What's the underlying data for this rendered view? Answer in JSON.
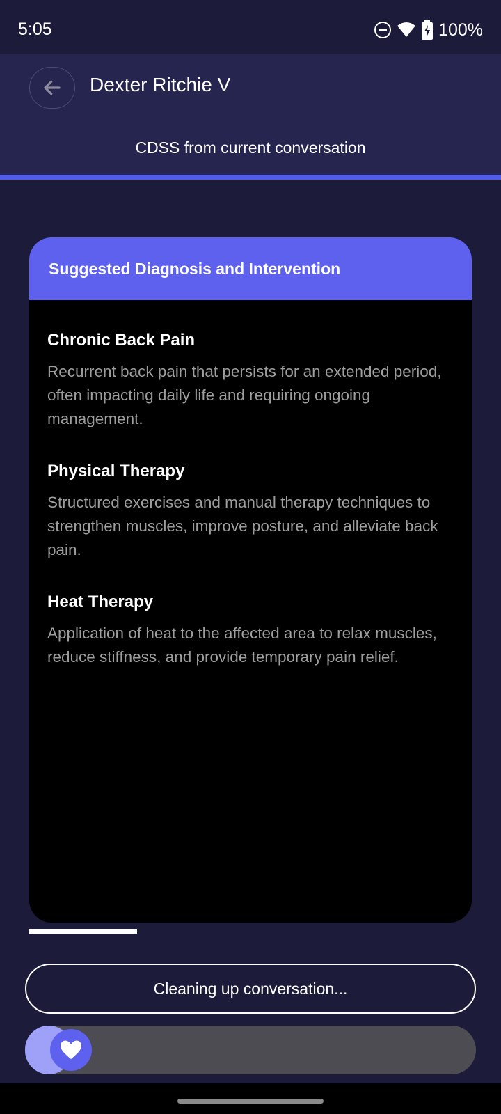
{
  "status_bar": {
    "time": "5:05",
    "battery": "100%",
    "icons": [
      "do-not-disturb-icon",
      "wifi-icon",
      "battery-charging-icon"
    ]
  },
  "header": {
    "back_icon": "arrow-left-icon",
    "title": "Dexter Ritchie V"
  },
  "subheader": {
    "label": "CDSS from current conversation"
  },
  "card": {
    "title": "Suggested Diagnosis and Intervention",
    "items": [
      {
        "title": "Chronic Back Pain",
        "description": "Recurrent back pain that persists for an extended period, often impacting daily life and requiring ongoing management."
      },
      {
        "title": "Physical Therapy",
        "description": "Structured exercises and manual therapy techniques to strengthen muscles, improve posture, and alleviate back pain."
      },
      {
        "title": "Heat Therapy",
        "description": "Application of heat to the affected area to relax muscles, reduce stiffness, and provide temporary pain relief."
      }
    ]
  },
  "footer": {
    "status_button_label": "Cleaning up conversation...",
    "slider_icon": "heart-icon"
  },
  "colors": {
    "background": "#1c1b3a",
    "header": "#26254f",
    "accent": "#5d61ee",
    "accent_line": "#4f5de8",
    "slider_track": "#4d4c52",
    "slider_fill": "#9fa0f8",
    "text_muted": "#9e9e9e"
  }
}
